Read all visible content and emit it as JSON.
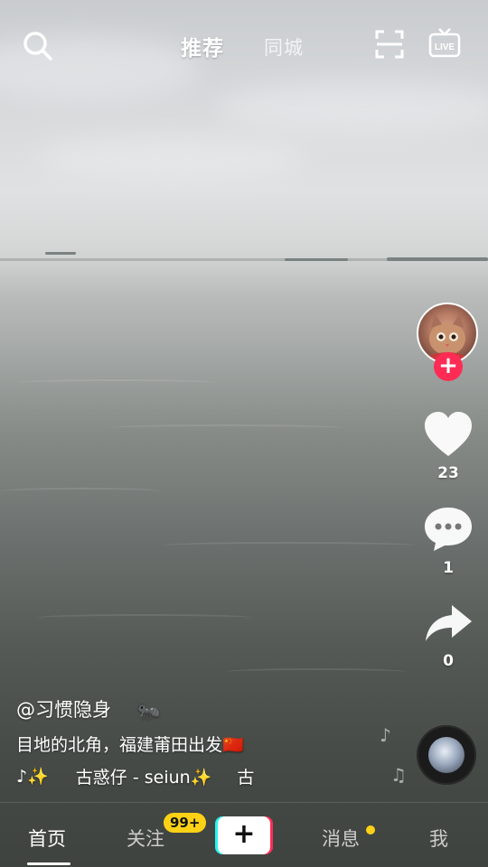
{
  "top_nav": {
    "tab_recommended": "推荐",
    "tab_local": "同城",
    "live_label": "LIVE"
  },
  "side_actions": {
    "like_count": "23",
    "comment_count": "1",
    "share_count": "0",
    "follow_symbol": "+"
  },
  "video_info": {
    "author": "@习惯隐身",
    "author_emoji": "🐜",
    "caption": "目地的北角，福建莆田出发🇨🇳",
    "music_prefix": "♪✨",
    "music_title": "古惑仔 - seiun✨",
    "music_marquee_next": "古"
  },
  "bottom_nav": {
    "home": "首页",
    "following": "关注",
    "following_badge": "99+",
    "create_symbol": "+",
    "messages": "消息",
    "me": "我"
  },
  "icons": [
    "search-icon",
    "scan-icon",
    "live-icon",
    "heart-icon",
    "comment-icon",
    "share-icon",
    "music-disc-icon",
    "music-note-icon"
  ],
  "colors": {
    "accent_red": "#fe2c55",
    "accent_cyan": "#25f4ee",
    "badge_yellow": "#fcd116"
  }
}
